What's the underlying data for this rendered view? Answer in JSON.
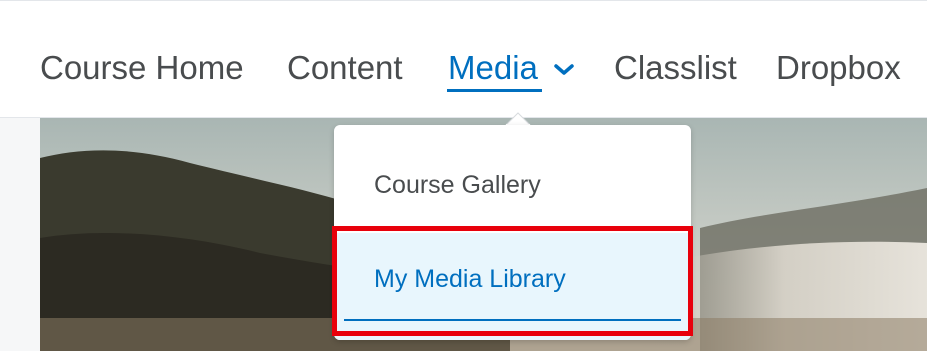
{
  "nav": {
    "items": [
      {
        "label": "Course Home"
      },
      {
        "label": "Content"
      },
      {
        "label": "Media",
        "active": true
      },
      {
        "label": "Classlist"
      },
      {
        "label": "Dropbox"
      }
    ]
  },
  "dropdown": {
    "items": [
      {
        "label": "Course Gallery"
      },
      {
        "label": "My Media Library",
        "selected": true
      }
    ]
  },
  "icons": {
    "media_toggle": "chevron-down-icon"
  },
  "colors": {
    "accent": "#006fbf",
    "text": "#494c4e",
    "highlight": "#e8000b",
    "selected_bg": "#e8f6fd"
  }
}
